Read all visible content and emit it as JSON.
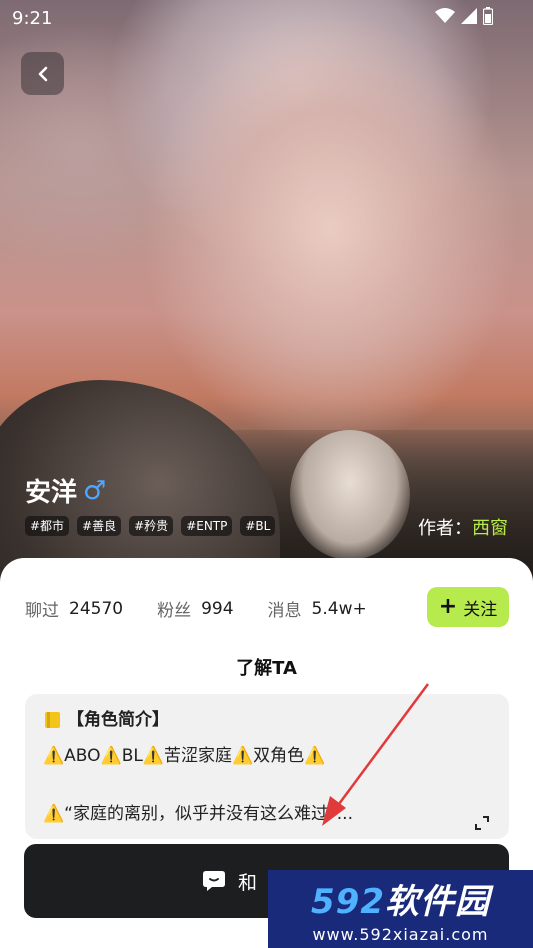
{
  "status_bar": {
    "time": "9:21"
  },
  "character": {
    "name": "安洋",
    "gender_symbol": "♂",
    "tags": [
      "#都市",
      "#善良",
      "#矜贵",
      "#ENTP",
      "#BL"
    ],
    "author_label": "作者：",
    "author_name": "西窗"
  },
  "stats": {
    "chatted_label": "聊过",
    "chatted_value": "24570",
    "fans_label": "粉丝",
    "fans_value": "994",
    "messages_label": "消息",
    "messages_value": "5.4w+"
  },
  "follow_button": {
    "plus": "+",
    "label": "关注"
  },
  "section_title": "了解TA",
  "intro": {
    "title": "【角色简介】",
    "line1": "⚠️ABO⚠️BL⚠️苦涩家庭⚠️双角色⚠️",
    "line2": "⚠️“家庭的离别，似乎并没有这么难过”..."
  },
  "chat_button": {
    "label": "和"
  },
  "watermark": {
    "logo_num": "592",
    "logo_text": "软件园",
    "url": "www.592xiazai.com"
  },
  "colors": {
    "accent": "#b7ea4c",
    "gender": "#4fa8ff",
    "chat_button_bg": "#1c1e1f",
    "arrow": "#e03a3a"
  },
  "icons": [
    "back-arrow-icon",
    "wifi-icon",
    "signal-icon",
    "battery-icon",
    "gender-male-icon",
    "book-icon",
    "expand-icon",
    "chat-bubble-icon"
  ]
}
